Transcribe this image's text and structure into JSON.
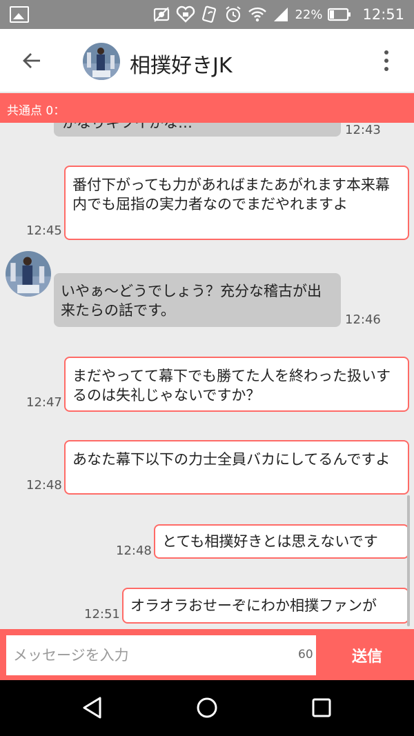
{
  "status_bar": {
    "battery_percent": "22%",
    "time": "12:51",
    "icons": [
      "image-icon",
      "nfc-off-icon",
      "heart-icon",
      "share-icon",
      "alarm-icon",
      "wifi-icon",
      "signal-icon",
      "battery-icon"
    ]
  },
  "header": {
    "title": "相撲好きJK",
    "back_icon": "arrow-left-icon",
    "menu_icon": "more-vert-icon"
  },
  "common_points": "共通点 0：",
  "messages": [
    {
      "side": "in",
      "text": "かなりキツイかな…",
      "time": "12:43"
    },
    {
      "side": "out",
      "text": "番付下がっても力があればまたあがれます本来幕内でも屈指の実力者なのでまだやれますよ",
      "time": "12:45"
    },
    {
      "side": "in",
      "text": "いやぁ～どうでしょう？充分な稽古が出来たらの話です。",
      "time": "12:46"
    },
    {
      "side": "out",
      "text": "まだやってて幕下でも勝てた人を終わった扱いするのは失礼じゃないですか？",
      "time": "12:47"
    },
    {
      "side": "out",
      "text": "あなた幕下以下の力士全員バカにしてるんですよ",
      "time": "12:48"
    },
    {
      "side": "out",
      "text": "とても相撲好きとは思えないです",
      "time": "12:48"
    },
    {
      "side": "out",
      "text": "オラオラおせーぞにわか相撲ファンが",
      "time": "12:51"
    }
  ],
  "input": {
    "placeholder": "メッセージを入力",
    "counter": "60",
    "send_label": "送信"
  },
  "colors": {
    "accent": "#ff6460",
    "statusbar": "#8a8a8a",
    "incoming_bubble": "#c9c9c9",
    "outgoing_border": "#ff6a66"
  }
}
